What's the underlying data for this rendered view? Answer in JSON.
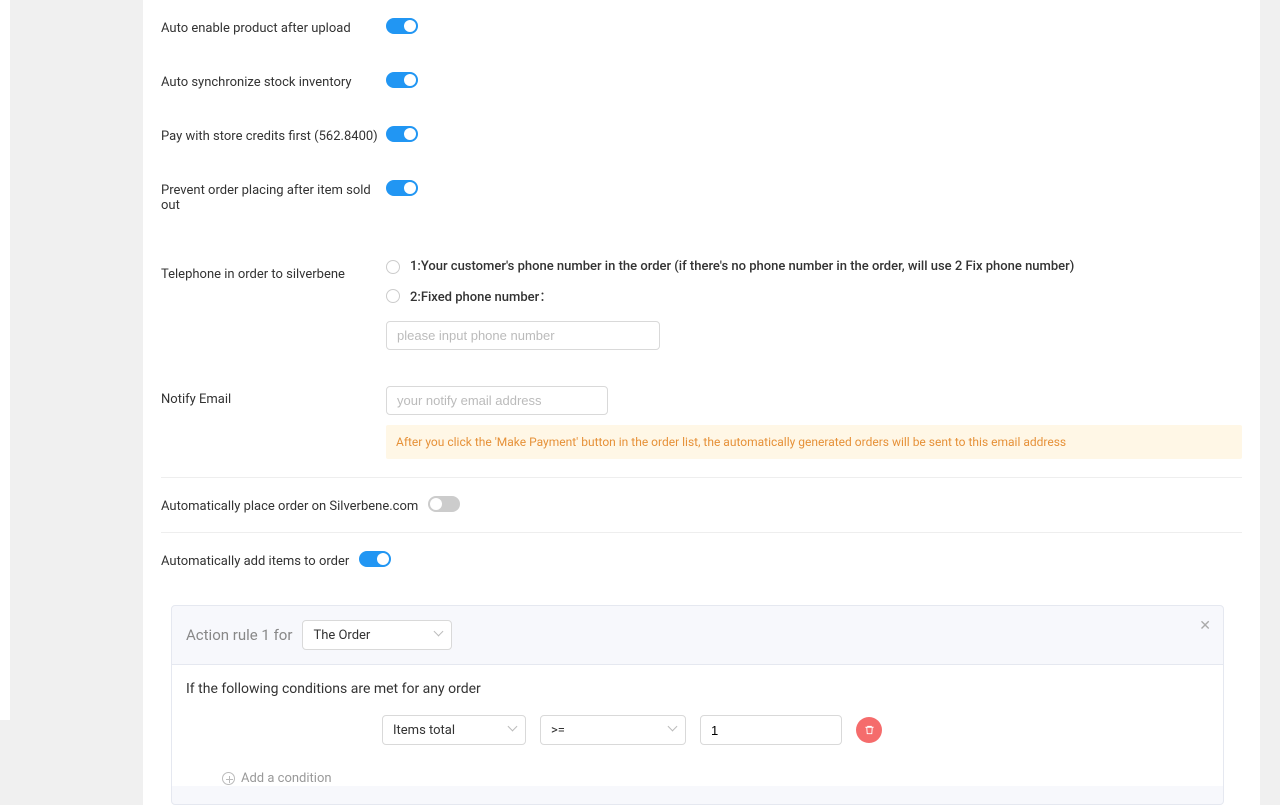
{
  "toggles": {
    "auto_enable": {
      "label": "Auto enable product after upload",
      "on": true
    },
    "auto_sync": {
      "label": "Auto synchronize stock inventory",
      "on": true
    },
    "pay_credits": {
      "label": "Pay with store credits first (562.8400)",
      "on": true
    },
    "prevent_sold_out": {
      "label": "Prevent order placing after item sold out",
      "on": true
    },
    "auto_place": {
      "label": "Automatically place order on Silverbene.com",
      "on": false
    },
    "auto_add": {
      "label": "Automatically add items to order",
      "on": true
    }
  },
  "telephone": {
    "label": "Telephone in order to silverbene",
    "opt1": "1:Your customer's phone number in the order (if there's no phone number in the order, will use 2 Fix phone number)",
    "opt2": "2:Fixed phone number：",
    "placeholder": "please input phone number"
  },
  "notify_email": {
    "label": "Notify Email",
    "placeholder": "your notify email address",
    "notice": "After you click the 'Make Payment' button in the order list, the automatically generated orders will be sent to this email address"
  },
  "rule": {
    "title": "Action rule 1 for",
    "target": "The Order",
    "subtitle": "If the following conditions are met for any order",
    "cond_field": "Items total",
    "cond_op": ">=",
    "cond_val": "1",
    "add_cond": "Add a condition"
  }
}
